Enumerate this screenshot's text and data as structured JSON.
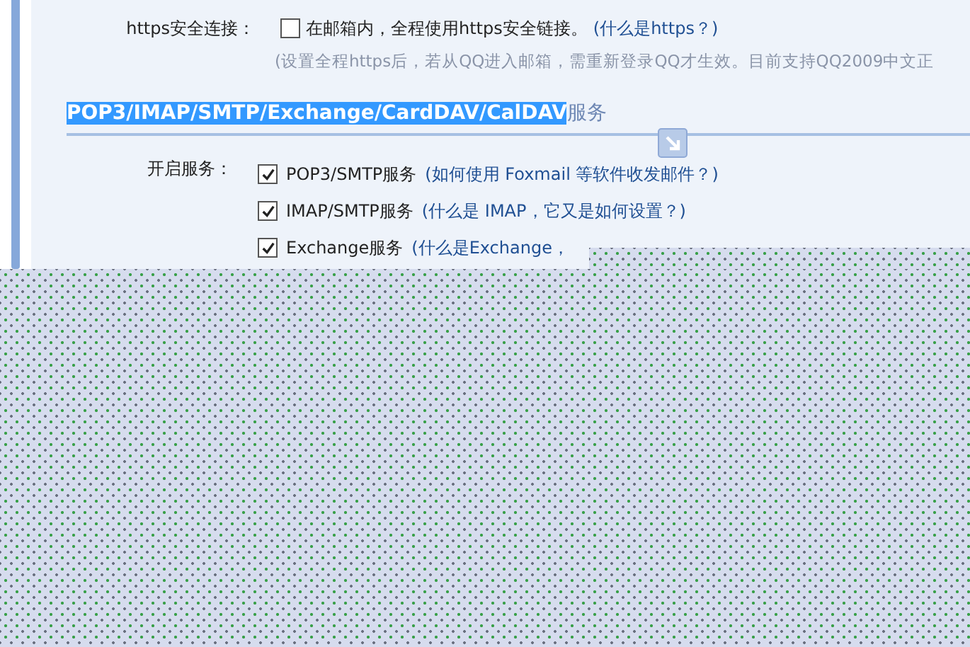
{
  "https_setting": {
    "label": "https安全连接：",
    "checked": false,
    "text": "在邮箱内，全程使用https安全链接。",
    "link": "(什么是https？)",
    "hint": "(设置全程https后，若从QQ进入邮箱，需重新登录QQ才生效。目前支持QQ2009中文正"
  },
  "section": {
    "title_selected": "POP3/IMAP/SMTP/Exchange/CardDAV/CalDAV",
    "title_rest": "服务"
  },
  "services": {
    "label": "开启服务：",
    "items": [
      {
        "name": "POP3/SMTP服务",
        "checked": true,
        "link": "(如何使用 Foxmail 等软件收发邮件？)"
      },
      {
        "name": "IMAP/SMTP服务",
        "checked": true,
        "link": "(什么是 IMAP，它又是如何设置？)"
      },
      {
        "name": "Exchange服务",
        "checked": true,
        "link": "(什么是Exchange，"
      }
    ]
  }
}
